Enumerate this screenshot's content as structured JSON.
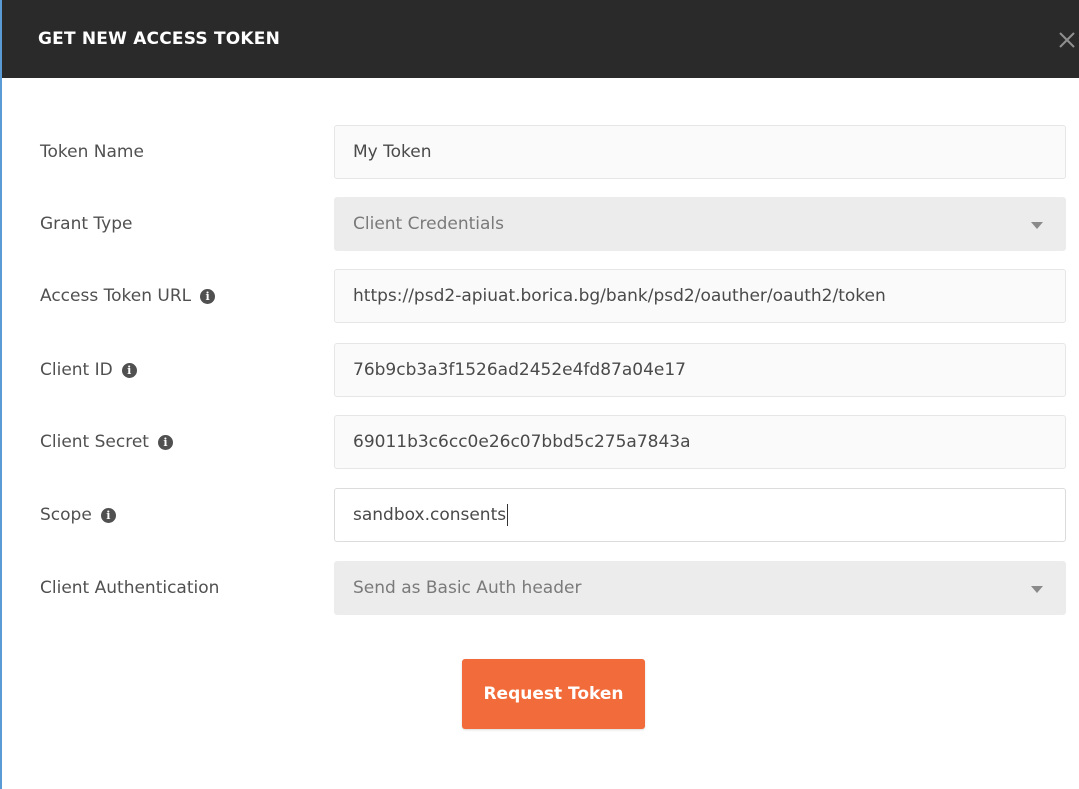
{
  "dialog": {
    "title": "GET NEW ACCESS TOKEN"
  },
  "form": {
    "token_name": {
      "label": "Token Name",
      "value": "My Token"
    },
    "grant_type": {
      "label": "Grant Type",
      "value": "Client Credentials"
    },
    "access_token_url": {
      "label": "Access Token URL",
      "value": "https://psd2-apiuat.borica.bg/bank/psd2/oauther/oauth2/token"
    },
    "client_id": {
      "label": "Client ID",
      "value": "76b9cb3a3f1526ad2452e4fd87a04e17"
    },
    "client_secret": {
      "label": "Client Secret",
      "value": "69011b3c6cc0e26c07bbd5c275a7843a"
    },
    "scope": {
      "label": "Scope",
      "value": "sandbox.consents"
    },
    "client_authentication": {
      "label": "Client Authentication",
      "value": "Send as Basic Auth header"
    }
  },
  "actions": {
    "request_token_label": "Request Token"
  },
  "icons": {
    "close": "close-icon",
    "info": "info-icon",
    "dropdown": "chevron-down-icon"
  },
  "colors": {
    "header_bg": "#2a2a2a",
    "accent": "#f26b3a",
    "field_bg": "#fafafa",
    "select_bg": "#ececec"
  }
}
